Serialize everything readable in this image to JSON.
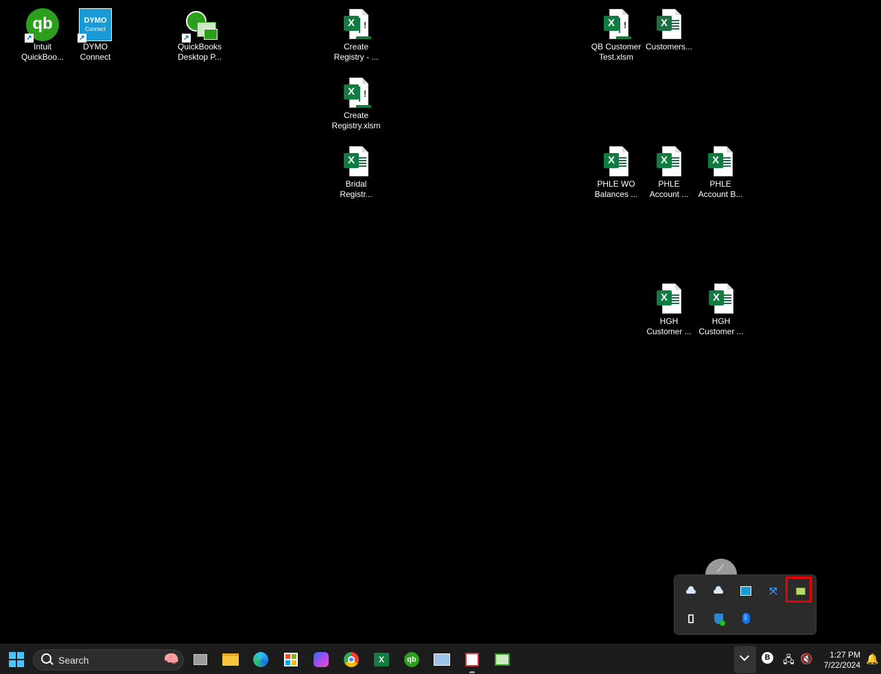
{
  "desktop": {
    "icons": [
      {
        "label": "Intuit\nQuickBoo..."
      },
      {
        "label": "DYMO\nConnect"
      },
      {
        "label": "QuickBooks\nDesktop P..."
      },
      {
        "label": "Create\nRegistry - ..."
      },
      {
        "label": "Create\nRegistry.xlsm"
      },
      {
        "label": "Bridal\nRegistr..."
      },
      {
        "label": "QB Customer\nTest.xlsm"
      },
      {
        "label": "Customers..."
      },
      {
        "label": "PHLE WO\nBalances ..."
      },
      {
        "label": "PHLE\nAccount ..."
      },
      {
        "label": "PHLE\nAccount B..."
      },
      {
        "label": "HGH\nCustomer ..."
      },
      {
        "label": "HGH\nCustomer ..."
      }
    ],
    "dymo_logo": {
      "line1": "DYMO",
      "line2": "Connect"
    },
    "qb_glyph": "qb"
  },
  "tray_flyout": {
    "icons": [
      "onedrive-icon",
      "onedrive-icon",
      "dymo-icon",
      "splashtop-icon",
      "quickbooks-update-icon",
      "usb-eject-icon",
      "security-icon",
      "bluetooth-icon"
    ]
  },
  "taskbar": {
    "search_placeholder": "Search",
    "time": "1:27 PM",
    "date": "7/22/2024",
    "apps": [
      "task-view",
      "file-explorer",
      "edge",
      "microsoft-store",
      "copilot",
      "chrome",
      "excel",
      "quickbooks",
      "photos",
      "snipping-tool",
      "quickbooks-desktop"
    ]
  },
  "colors": {
    "excel": "#107c41",
    "quickbooks": "#2ca01c",
    "dymo": "#1a9ad6",
    "accent": "#4cc2ff",
    "highlight": "#ee0000"
  }
}
